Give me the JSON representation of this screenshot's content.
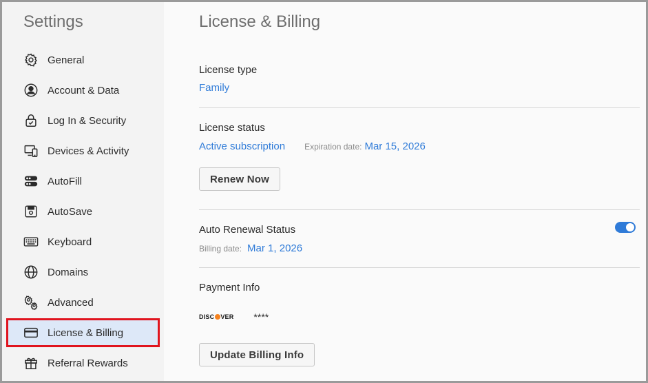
{
  "sidebar": {
    "title": "Settings",
    "items": [
      {
        "label": "General",
        "icon": "gear-icon"
      },
      {
        "label": "Account & Data",
        "icon": "user-circle-icon"
      },
      {
        "label": "Log In & Security",
        "icon": "lock-icon"
      },
      {
        "label": "Devices & Activity",
        "icon": "devices-icon"
      },
      {
        "label": "AutoFill",
        "icon": "autofill-icon"
      },
      {
        "label": "AutoSave",
        "icon": "save-icon"
      },
      {
        "label": "Keyboard",
        "icon": "keyboard-icon"
      },
      {
        "label": "Domains",
        "icon": "globe-icon"
      },
      {
        "label": "Advanced",
        "icon": "gears-icon"
      },
      {
        "label": "License & Billing",
        "icon": "credit-card-icon",
        "active": true
      },
      {
        "label": "Referral Rewards",
        "icon": "gift-icon"
      }
    ]
  },
  "main": {
    "title": "License & Billing",
    "license_type": {
      "label": "License type",
      "value": "Family"
    },
    "license_status": {
      "label": "License status",
      "value": "Active subscription",
      "expiration_label": "Expiration date:",
      "expiration_value": "Mar 15, 2026",
      "renew_button": "Renew Now"
    },
    "auto_renewal": {
      "label": "Auto Renewal Status",
      "enabled": true,
      "billing_label": "Billing date:",
      "billing_value": "Mar 1, 2026"
    },
    "payment": {
      "label": "Payment Info",
      "card_brand_parts": [
        "DISC",
        "VER"
      ],
      "card_masked": "****",
      "update_button": "Update Billing Info"
    }
  },
  "colors": {
    "accent": "#2f7bd8",
    "active_bg": "#dde8f8",
    "highlight_outline": "#e0141e"
  }
}
